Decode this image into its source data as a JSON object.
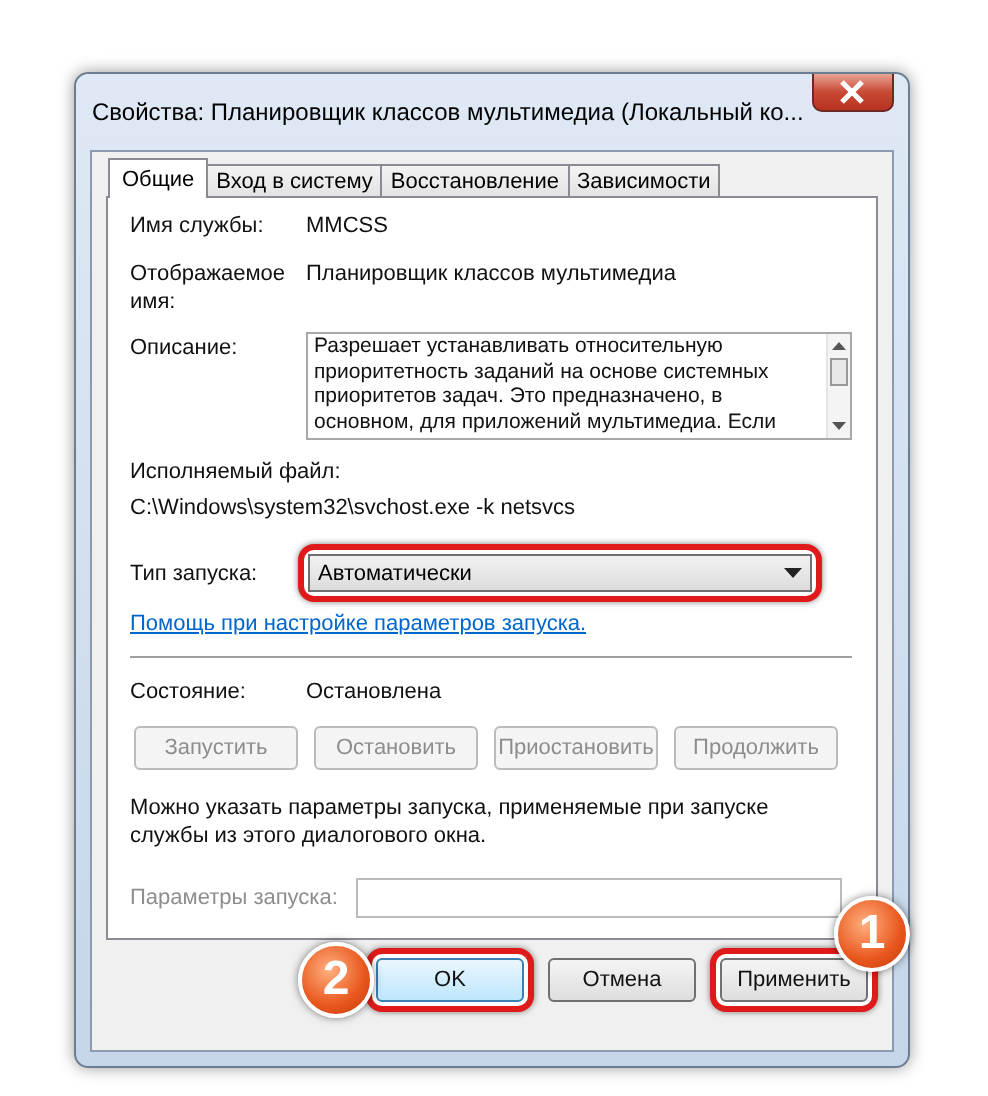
{
  "window": {
    "title": "Свойства: Планировщик классов мультимедиа (Локальный ко..."
  },
  "tabs": [
    {
      "label": "Общие",
      "selected": true
    },
    {
      "label": "Вход в систему",
      "selected": false
    },
    {
      "label": "Восстановление",
      "selected": false
    },
    {
      "label": "Зависимости",
      "selected": false
    }
  ],
  "fields": [
    {
      "label": "Имя службы:",
      "value": "MMCSS"
    },
    {
      "label": "Отображаемое имя:",
      "value": "Планировщик классов мультимедиа"
    }
  ],
  "description": {
    "label": "Описание:",
    "lines": [
      "Разрешает устанавливать относительную",
      "приоритетность заданий на основе системных",
      "приоритетов задач. Это предназначено, в",
      "основном, для приложений мультимедиа.  Если"
    ]
  },
  "executable": {
    "label": "Исполняемый файл:",
    "path": "C:\\Windows\\system32\\svchost.exe -k netsvcs"
  },
  "startup_type": {
    "label": "Тип запуска:",
    "value": "Автоматически",
    "highlighted": true
  },
  "help_link": "Помощь при настройке параметров запуска.",
  "status": {
    "label": "Состояние:",
    "value": "Остановлена"
  },
  "service_buttons": [
    {
      "label": "Запустить",
      "disabled": true
    },
    {
      "label": "Остановить",
      "disabled": true
    },
    {
      "label": "Приостановить",
      "disabled": true
    },
    {
      "label": "Продолжить",
      "disabled": true
    }
  ],
  "hint": "Можно указать параметры запуска, применяемые при запуске службы из этого диалогового окна.",
  "start_params": {
    "label": "Параметры запуска:",
    "disabled": true
  },
  "buttons": [
    {
      "label": "OK",
      "default": true,
      "highlighted": true,
      "callout": "2"
    },
    {
      "label": "Отмена",
      "default": false,
      "highlighted": false
    },
    {
      "label": "Применить",
      "default": false,
      "highlighted": true,
      "callout": "1"
    }
  ]
}
